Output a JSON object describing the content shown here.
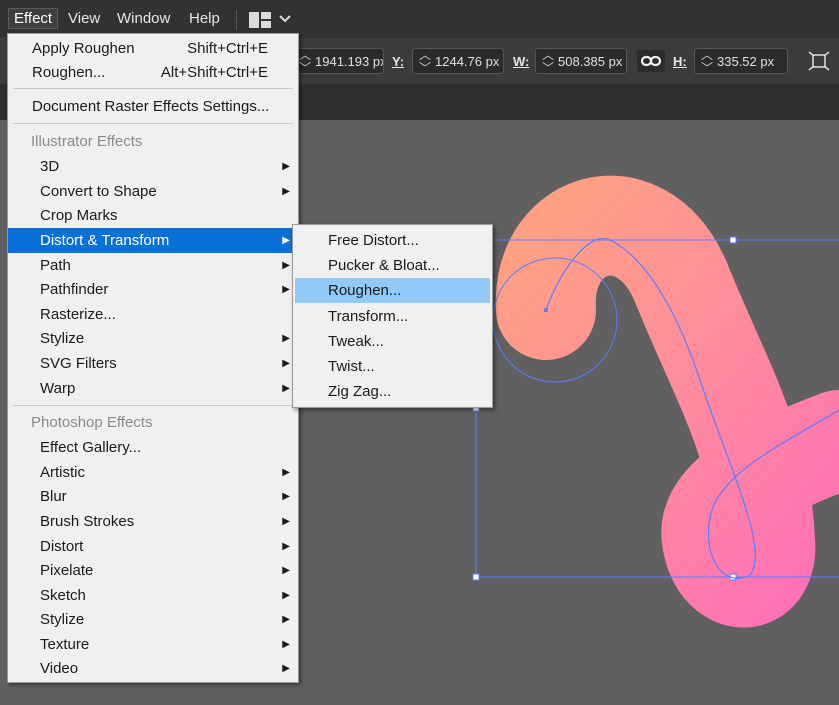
{
  "menubar": {
    "items": [
      "Effect",
      "View",
      "Window",
      "Help"
    ],
    "workspace_icon": "workspace-layout-icon",
    "chevron_icon": "chevron-down-icon"
  },
  "options": {
    "x_value": "1941.193 px",
    "y_label": "Y:",
    "y_value": "1244.76 px",
    "w_label": "W:",
    "w_value": "508.385 px",
    "h_label": "H:",
    "h_value": "335.52 px",
    "link_icon": "link-icon",
    "transform_icon": "transform-icon"
  },
  "effect_menu": {
    "apply": {
      "label": "Apply Roughen",
      "shortcut": "Shift+Ctrl+E"
    },
    "last": {
      "label": "Roughen...",
      "shortcut": "Alt+Shift+Ctrl+E"
    },
    "raster_settings": "Document Raster Effects Settings...",
    "illustrator_header": "Illustrator Effects",
    "illustrator_items": [
      "3D",
      "Convert to Shape",
      "Crop Marks",
      "Distort & Transform",
      "Path",
      "Pathfinder",
      "Rasterize...",
      "Stylize",
      "SVG Filters",
      "Warp"
    ],
    "photoshop_header": "Photoshop Effects",
    "photoshop_items": [
      "Effect Gallery...",
      "Artistic",
      "Blur",
      "Brush Strokes",
      "Distort",
      "Pixelate",
      "Sketch",
      "Stylize",
      "Texture",
      "Video"
    ]
  },
  "submenu": {
    "items": [
      "Free Distort...",
      "Pucker & Bloat...",
      "Roughen...",
      "Transform...",
      "Tweak...",
      "Twist...",
      "Zig Zag..."
    ]
  },
  "colors": {
    "highlight": "#0a6fd6",
    "hover": "#91c9f7",
    "stroke_start": "#ff9a8b",
    "stroke_end": "#ff6fb5",
    "stroke_purple": "#c77dff",
    "selection": "#5b7cff"
  }
}
